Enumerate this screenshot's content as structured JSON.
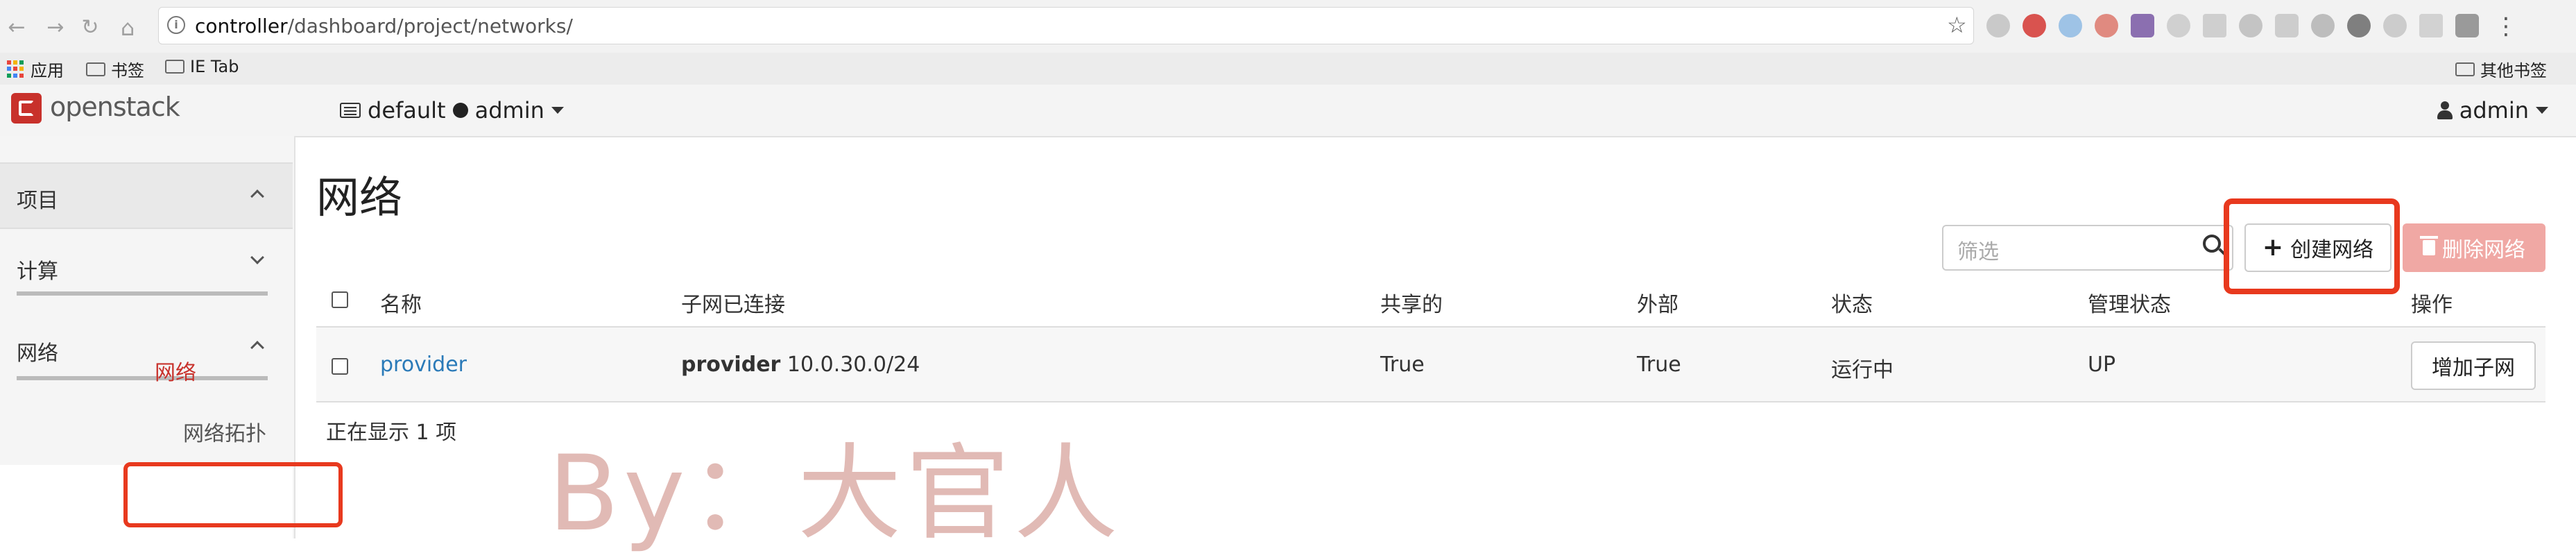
{
  "browser": {
    "url_host": "controller",
    "url_path": "/dashboard/project/networks/",
    "extensions": [
      "ext-icon-1",
      "abp-icon",
      "ext-icon-3",
      "ext-icon-4",
      "ext-icon-5",
      "ext-icon-6",
      "ext-icon-7",
      "ext-icon-8",
      "ext-icon-9",
      "ext-icon-10",
      "ext-icon-11",
      "ext-icon-12",
      "ext-icon-13",
      "ext-icon-14"
    ]
  },
  "bookmarks": {
    "apps_label": "应用",
    "items": [
      "书签",
      "IE Tab"
    ],
    "other_label": "其他书签"
  },
  "topnav": {
    "logo_text": "openstack",
    "project_domain": "default",
    "project_name": "admin",
    "user_name": "admin"
  },
  "sidebar": {
    "project": "项目",
    "compute": "计算",
    "network": "网络",
    "topology": "网络拓扑",
    "networks": "网络"
  },
  "main": {
    "title": "网络",
    "filter_placeholder": "筛选",
    "create_label": "创建网络",
    "delete_label": "删除网络",
    "columns": [
      "名称",
      "子网已连接",
      "共享的",
      "外部",
      "状态",
      "管理状态",
      "操作"
    ],
    "rows": [
      {
        "name": "provider",
        "subnet_name": "provider",
        "subnet_cidr": "10.0.30.0/24",
        "shared": "True",
        "external": "True",
        "status": "运行中",
        "admin_state": "UP",
        "action": "增加子网"
      }
    ],
    "footer": "正在显示 1 项"
  },
  "watermark": "By：大官人",
  "colors": {
    "brand": "#c8312b",
    "link": "#2a7ab8",
    "highlight": "#e8391e",
    "danger_disabled": "#f0a8a4"
  }
}
